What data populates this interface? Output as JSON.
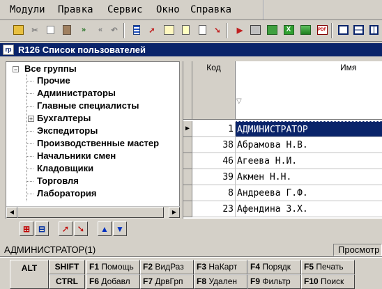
{
  "menu": {
    "items": [
      "Модули",
      "Правка",
      "Сервис",
      "Окно",
      "Справка"
    ]
  },
  "toolbar": {
    "icons": [
      "open-folder-icon",
      "cut-icon",
      "copy-icon",
      "paste-icon",
      "fast-forward-icon",
      "rewind-icon",
      "undo-icon",
      "list-icon",
      "edit-arrow-icon",
      "properties-icon",
      "new-document-icon",
      "document-icon",
      "red-arrow-icon",
      "export-icon",
      "print-icon",
      "excel-icon",
      "excel-export-icon",
      "image-icon",
      "pdf-export-icon",
      "cascade-windows-icon",
      "tile-horizontal-icon",
      "tile-vertical-icon"
    ]
  },
  "window": {
    "title": "R126 Список пользователей"
  },
  "tree": {
    "root": "Все группы",
    "items": [
      "Прочие",
      "Администраторы",
      "Главные специалисты",
      "Бухгалтеры",
      "Экспедиторы",
      "Производственные мастер",
      "Начальники смен",
      "Кладовщики",
      "Торговля",
      "Лаборатория"
    ],
    "collapsed_item_index": 3
  },
  "grid": {
    "columns": {
      "kod": "Код",
      "name": "Имя"
    },
    "filter_symbol": "▽",
    "rows": [
      {
        "kod": "1",
        "name": "АДМИНИСТРАТОР"
      },
      {
        "kod": "38",
        "name": "Абрамова Н.В."
      },
      {
        "kod": "46",
        "name": "Агеева Н.И."
      },
      {
        "kod": "39",
        "name": "Акмен Н.Н."
      },
      {
        "kod": "8",
        "name": "Андреева Г.Ф."
      },
      {
        "kod": "23",
        "name": "Афендина З.Х."
      }
    ],
    "selected_row": 0
  },
  "status": {
    "left": "АДМИНИСТРАТОР(1)",
    "right": "Просмотр"
  },
  "fkeys": {
    "alt": "ALT",
    "shift": "SHIFT",
    "ctrl": "CTRL",
    "row1": [
      {
        "key": "F1",
        "label": "Помощь"
      },
      {
        "key": "F2",
        "label": "ВидРаз"
      },
      {
        "key": "F3",
        "label": "НаКарт"
      },
      {
        "key": "F4",
        "label": "Порядк"
      },
      {
        "key": "F5",
        "label": "Печать"
      }
    ],
    "row2": [
      {
        "key": "F6",
        "label": "Добавл"
      },
      {
        "key": "F7",
        "label": "ДрвГрп"
      },
      {
        "key": "F8",
        "label": "Удален"
      },
      {
        "key": "F9",
        "label": "Фильтр"
      },
      {
        "key": "F10",
        "label": "Поиск"
      }
    ]
  },
  "colors": {
    "title_bar": "#0a246a",
    "selection": "#0a246a",
    "face": "#d4d0c8"
  }
}
